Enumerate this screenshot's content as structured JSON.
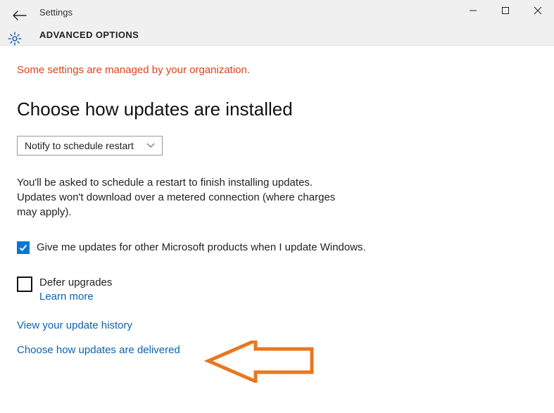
{
  "window": {
    "app_name": "Settings",
    "page_title": "ADVANCED OPTIONS"
  },
  "main": {
    "org_message": "Some settings are managed by your organization.",
    "heading": "Choose how updates are installed",
    "dropdown_value": "Notify to schedule restart",
    "description": "You'll be asked to schedule a restart to finish installing updates. Updates won't download over a metered connection (where charges may apply).",
    "checkbox_other_products": {
      "checked": true,
      "label": "Give me updates for other Microsoft products when I update Windows."
    },
    "checkbox_defer": {
      "checked": false,
      "label": "Defer upgrades",
      "learn_more": "Learn more"
    },
    "link_history": "View your update history",
    "link_delivery": "Choose how updates are delivered"
  },
  "icons": {
    "back": "back-arrow-icon",
    "gear": "gear-icon",
    "minimize": "minimize-icon",
    "maximize": "maximize-icon",
    "close": "close-icon",
    "chevron": "chevron-down-icon",
    "check": "checkmark-icon"
  },
  "colors": {
    "accent": "#0078d7",
    "link": "#0a63b2",
    "org_warning": "#d9441a",
    "annotation": "#e87722"
  }
}
